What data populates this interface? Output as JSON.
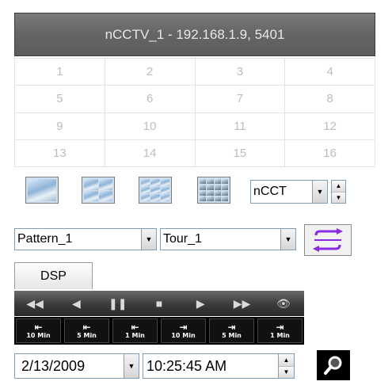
{
  "title": "nCCTV_1 - 192.168.1.9, 5401",
  "channels": [
    "1",
    "2",
    "3",
    "4",
    "5",
    "6",
    "7",
    "8",
    "9",
    "10",
    "11",
    "12",
    "13",
    "14",
    "15",
    "16"
  ],
  "layout_buttons": [
    {
      "icon": "single-view-icon"
    },
    {
      "icon": "quad-view-icon"
    },
    {
      "icon": "nine-view-icon"
    },
    {
      "icon": "sixteen-view-icon"
    }
  ],
  "device_select": {
    "value": "nCCT"
  },
  "pattern_select": {
    "value": "Pattern_1"
  },
  "tour_select": {
    "value": "Tour_1"
  },
  "dsp_label": "DSP",
  "playback": {
    "rewind": "◀◀",
    "back": "◀",
    "pause": "❚❚",
    "stop": "■",
    "play": "▶",
    "fast_forward": "▶▶",
    "eye": "👁"
  },
  "jumps": [
    {
      "arrow": "⇤",
      "label": "10 Min"
    },
    {
      "arrow": "⇤",
      "label": "5 Min"
    },
    {
      "arrow": "⇤",
      "label": "1 Min"
    },
    {
      "arrow": "⇥",
      "label": "10 Min"
    },
    {
      "arrow": "⇥",
      "label": "5 Min"
    },
    {
      "arrow": "⇥",
      "label": "1 Min"
    }
  ],
  "date_select": {
    "value": "2/13/2009"
  },
  "time_field": {
    "value": "10:25:45 AM"
  },
  "colors": {
    "tour_icon": "#8a2be2",
    "title_bg": "#666666"
  }
}
